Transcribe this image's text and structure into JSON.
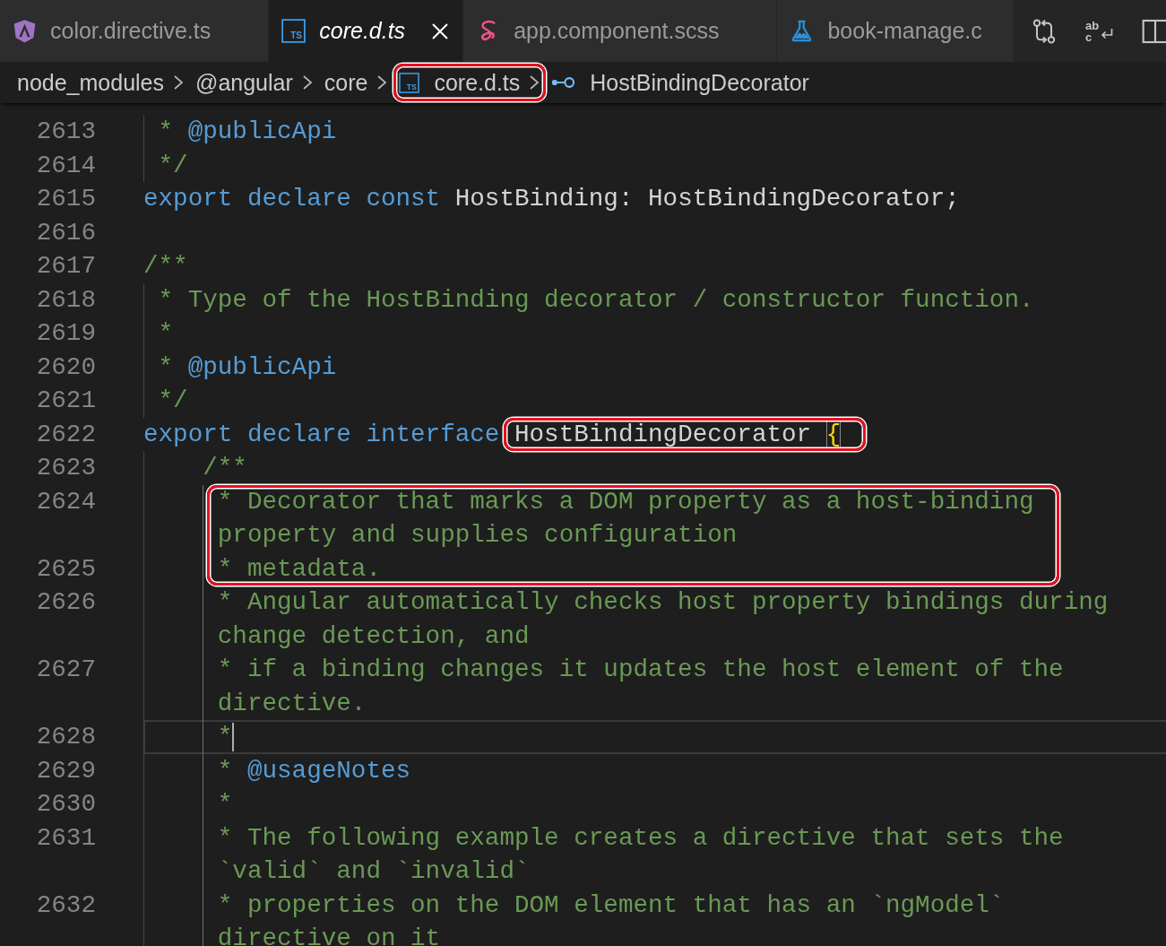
{
  "tabs": [
    {
      "label": "color.directive.ts",
      "kind": "component",
      "selected": false,
      "preview": false
    },
    {
      "label": "core.d.ts",
      "kind": "typescript",
      "badge": "TS",
      "selected": true,
      "preview": true
    },
    {
      "label": "app.component.scss",
      "kind": "stylesheet",
      "selected": false,
      "preview": false
    },
    {
      "label": "book-manage.c",
      "kind": "test",
      "selected": false,
      "preview": false
    }
  ],
  "editor_actions": [
    {
      "kind": "compare"
    },
    {
      "kind": "letters",
      "letters": [
        "ab",
        "c"
      ]
    },
    {
      "kind": "split"
    }
  ],
  "breadcrumbs": [
    {
      "label": "node_modules",
      "kind": "folder",
      "highlighted": false
    },
    {
      "label": "@angular",
      "kind": "folder",
      "highlighted": false
    },
    {
      "label": "core",
      "kind": "folder",
      "highlighted": false
    },
    {
      "label": "core.d.ts",
      "kind": "typescript",
      "badge": "TS",
      "highlighted": true
    },
    {
      "label": "HostBindingDecorator",
      "kind": "interface",
      "highlighted": false
    }
  ],
  "code": {
    "lines": [
      {
        "number": "2613",
        "current": false,
        "rows": [
          [
            {
              "kind": "comment",
              "text": " * ",
              "highlighted": false
            },
            {
              "kind": "tag",
              "text": "@publicApi",
              "highlighted": false
            }
          ]
        ]
      },
      {
        "number": "2614",
        "current": false,
        "rows": [
          [
            {
              "kind": "comment",
              "text": " */",
              "highlighted": false
            }
          ]
        ]
      },
      {
        "number": "2615",
        "current": false,
        "rows": [
          [
            {
              "kind": "keyword",
              "text": "export declare const ",
              "highlighted": false
            },
            {
              "kind": "plain",
              "text": "HostBinding: HostBindingDecorator;",
              "highlighted": false
            }
          ]
        ]
      },
      {
        "number": "2616",
        "current": false
      },
      {
        "number": "2617",
        "current": false,
        "rows": [
          [
            {
              "kind": "comment",
              "text": "/**",
              "highlighted": false
            }
          ]
        ]
      },
      {
        "number": "2618",
        "current": false,
        "rows": [
          [
            {
              "kind": "comment",
              "text": " * Type of the HostBinding decorator / constructor function.",
              "highlighted": false
            }
          ]
        ]
      },
      {
        "number": "2619",
        "current": false,
        "rows": [
          [
            {
              "kind": "comment",
              "text": " *",
              "highlighted": false
            }
          ]
        ]
      },
      {
        "number": "2620",
        "current": false,
        "rows": [
          [
            {
              "kind": "comment",
              "text": " * ",
              "highlighted": false
            },
            {
              "kind": "tag",
              "text": "@publicApi",
              "highlighted": false
            }
          ]
        ]
      },
      {
        "number": "2621",
        "current": false,
        "rows": [
          [
            {
              "kind": "comment",
              "text": " */",
              "highlighted": false
            }
          ]
        ]
      },
      {
        "number": "2622",
        "current": false,
        "rows": [
          [
            {
              "kind": "keyword",
              "text": "export declare interface ",
              "highlighted": false
            },
            {
              "kind": "plain",
              "text": "HostBindingDecorator ",
              "highlighted": true
            },
            {
              "kind": "bracket",
              "text": "{",
              "highlighted": true,
              "matched": true
            }
          ]
        ]
      },
      {
        "number": "2623",
        "current": false,
        "rows": [
          [
            {
              "kind": "comment",
              "text": "    /**",
              "highlighted": false
            }
          ]
        ]
      },
      {
        "number": "2624",
        "current": false,
        "rows": [
          [
            {
              "kind": "comment",
              "text": "     * Decorator that marks a DOM property as a host-binding",
              "highlighted": true
            }
          ],
          [
            {
              "kind": "comment",
              "text": "property and supplies configuration",
              "highlighted": true
            }
          ]
        ]
      },
      {
        "number": "2625",
        "current": false,
        "rows": [
          [
            {
              "kind": "comment",
              "text": "     * metadata.",
              "highlighted": true
            }
          ]
        ]
      },
      {
        "number": "2626",
        "current": false,
        "rows": [
          [
            {
              "kind": "comment",
              "text": "     * Angular automatically checks host property bindings during",
              "highlighted": false
            }
          ],
          [
            {
              "kind": "comment",
              "text": "change detection, and",
              "highlighted": false
            }
          ]
        ]
      },
      {
        "number": "2627",
        "current": false,
        "rows": [
          [
            {
              "kind": "comment",
              "text": "     * if a binding changes it updates the host element of the",
              "highlighted": false
            }
          ],
          [
            {
              "kind": "comment",
              "text": "directive.",
              "highlighted": false
            }
          ]
        ]
      },
      {
        "number": "2628",
        "current": true,
        "rows": [
          [
            {
              "kind": "comment",
              "text": "     *",
              "highlighted": false
            }
          ]
        ]
      },
      {
        "number": "2629",
        "current": false,
        "rows": [
          [
            {
              "kind": "comment",
              "text": "     * ",
              "highlighted": false
            },
            {
              "kind": "tag",
              "text": "@usageNotes",
              "highlighted": false
            }
          ]
        ]
      },
      {
        "number": "2630",
        "current": false,
        "rows": [
          [
            {
              "kind": "comment",
              "text": "     *",
              "highlighted": false
            }
          ]
        ]
      },
      {
        "number": "2631",
        "current": false,
        "rows": [
          [
            {
              "kind": "comment",
              "text": "     * The following example creates a directive that sets the",
              "highlighted": false
            }
          ],
          [
            {
              "kind": "comment",
              "text": "`valid` and `invalid`",
              "highlighted": false
            }
          ]
        ]
      },
      {
        "number": "2632",
        "current": false,
        "rows": [
          [
            {
              "kind": "comment",
              "text": "     * properties on the DOM element that has an `ngModel`",
              "highlighted": false
            }
          ],
          [
            {
              "kind": "comment",
              "text": "directive on it",
              "highlighted": false
            }
          ]
        ]
      }
    ]
  }
}
